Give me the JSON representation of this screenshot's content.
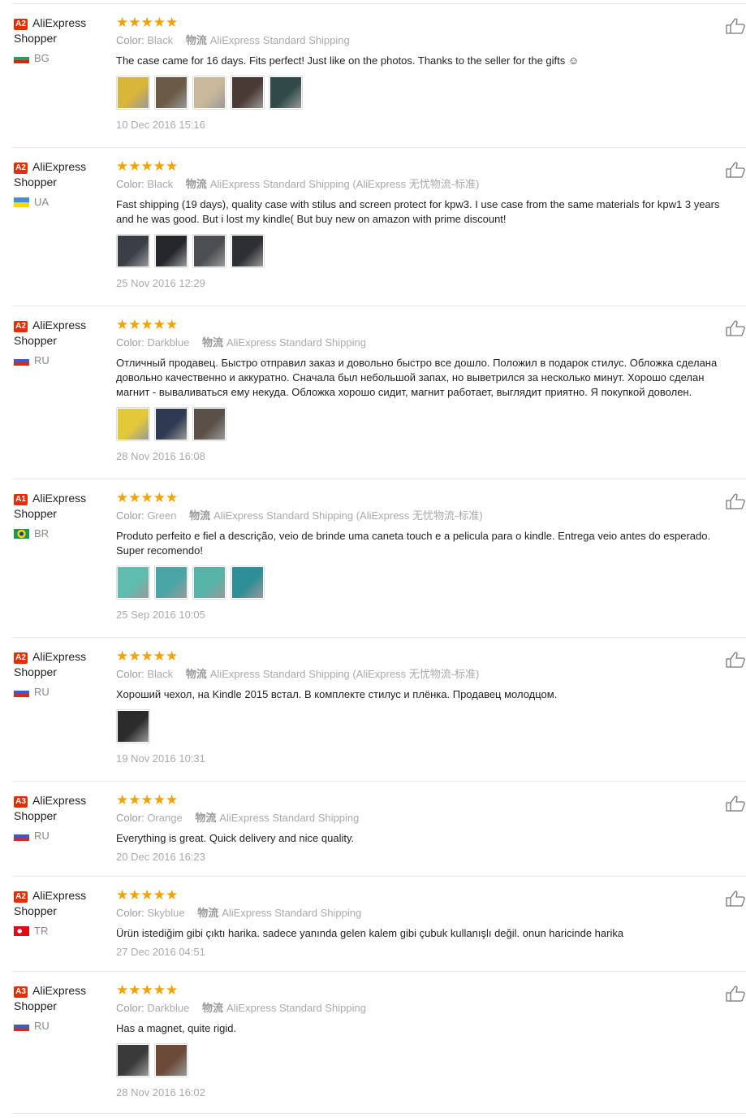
{
  "labels": {
    "color_prefix": "Color:",
    "logistics_prefix": "物流",
    "nickname": "AliExpress Shopper"
  },
  "reviews": [
    {
      "level": "A2",
      "country": "BG",
      "color": "Black",
      "shipping": "AliExpress Standard Shipping",
      "text": "The case came for 16 days. Fits perfect! Just like on the photos. Thanks to the seller for the gifts ☺",
      "date": "10 Dec 2016 15:16",
      "rating": 5,
      "thumbs": [
        "#d9b53a",
        "#6b5a45",
        "#c9b99a",
        "#4a3a36",
        "#2f4a48"
      ]
    },
    {
      "level": "A2",
      "country": "UA",
      "color": "Black",
      "shipping": "AliExpress Standard Shipping (AliExpress 无忧物流-标准)",
      "text": "Fast shipping (19 days), quality case with stilus and screen protect for kpw3. I use case from the same materials for kpw1 3 years and he was good. But i lost my kindle( But buy new on amazon with prime discount!",
      "date": "25 Nov 2016 12:29",
      "rating": 5,
      "thumbs": [
        "#3a3e46",
        "#24272c",
        "#4b4e52",
        "#2d2f33"
      ]
    },
    {
      "level": "A2",
      "country": "RU",
      "color": "Darkblue",
      "shipping": "AliExpress Standard Shipping",
      "text": "Отличный продавец. Быстро отправил заказ и довольно быстро все дошло. Положил в подарок стилус. Обложка сделана довольно качественно и аккуратно. Сначала был небольшой запах, но выветрился за несколько минут. Хорошо сделан магнит - вываливаться ему некуда. Обложка хорошо сидит, магнит работает, выглядит приятно. Я покупкой доволен.",
      "date": "28 Nov 2016 16:08",
      "rating": 5,
      "thumbs": [
        "#e3c93a",
        "#2d3a52",
        "#5a5048"
      ]
    },
    {
      "level": "A1",
      "country": "BR",
      "color": "Green",
      "shipping": "AliExpress Standard Shipping (AliExpress 无忧物流-标准)",
      "text": "Produto perfeito e fiel a descrição, veio de brinde uma caneta touch e a pelicula para o kindle. Entrega veio antes do esperado. Super recomendo!",
      "date": "25 Sep 2016 10:05",
      "rating": 5,
      "thumbs": [
        "#5fbdb0",
        "#4aa6a6",
        "#56b3a8",
        "#2e8e98"
      ]
    },
    {
      "level": "A2",
      "country": "RU",
      "color": "Black",
      "shipping": "AliExpress Standard Shipping (AliExpress 无忧物流-标准)",
      "text": "Хороший чехол, на Kindle 2015 встал. В комплекте стилус и плёнка. Продавец молодцом.",
      "date": "19 Nov 2016 10:31",
      "rating": 5,
      "thumbs": [
        "#2b2b2b"
      ]
    },
    {
      "level": "A3",
      "country": "RU",
      "color": "Orange",
      "shipping": "AliExpress Standard Shipping",
      "text": "Everything is great. Quick delivery and nice quality.",
      "date": "20 Dec 2016 16:23",
      "rating": 5,
      "thumbs": []
    },
    {
      "level": "A2",
      "country": "TR",
      "color": "Skyblue",
      "shipping": "AliExpress Standard Shipping",
      "text": "Ürün istediğim gibi çıktı harika. sadece yanında gelen kalem gibi çubuk kullanışlı değil. onun haricinde harika",
      "date": "27 Dec 2016 04:51",
      "rating": 5,
      "thumbs": []
    },
    {
      "level": "A3",
      "country": "RU",
      "color": "Darkblue",
      "shipping": "AliExpress Standard Shipping",
      "text": "Has a magnet, quite rigid.",
      "date": "28 Nov 2016 16:02",
      "rating": 5,
      "thumbs": [
        "#3a3a3a",
        "#6b4a3a"
      ]
    }
  ],
  "icons": {
    "star": "star-icon",
    "like": "thumbs-up-icon"
  },
  "colors": {
    "star": "#f5a100",
    "level_badge": "#e62e04",
    "meta_text": "#999999",
    "divider": "#e8e8e8"
  }
}
